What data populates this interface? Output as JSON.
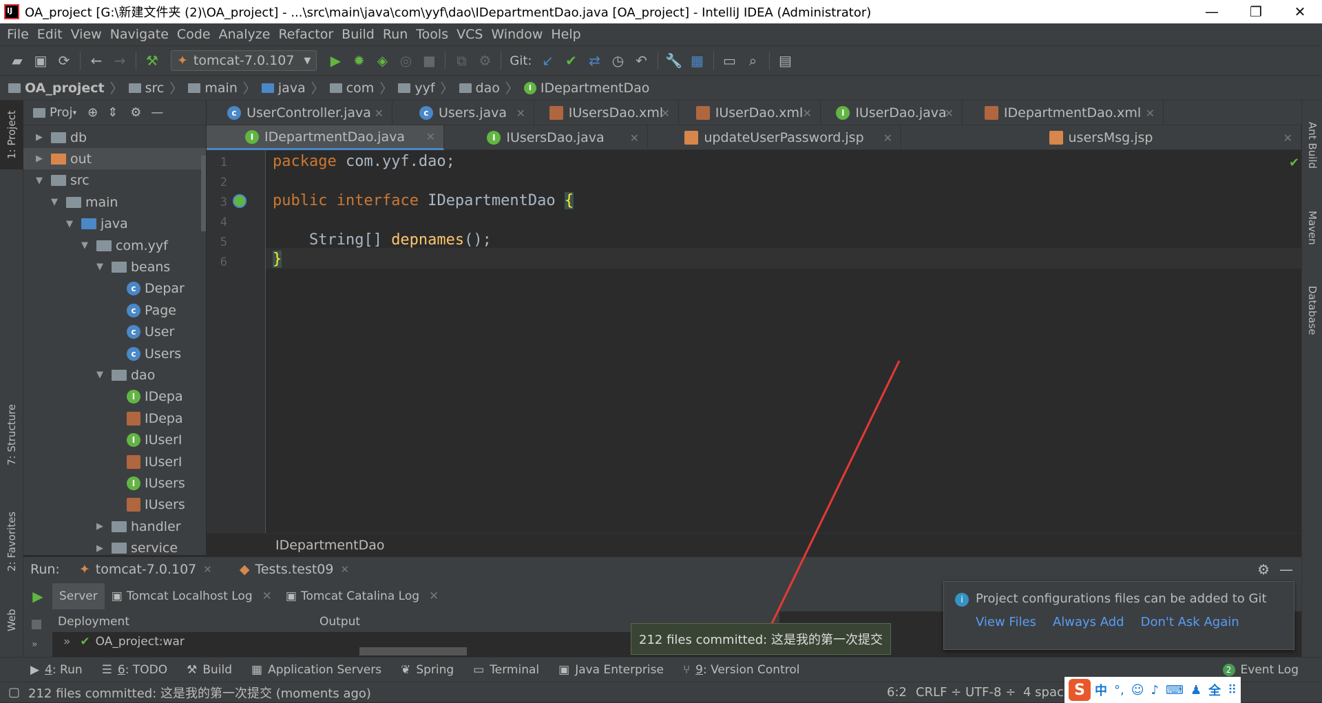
{
  "window": {
    "title": "OA_project [G:\\新建文件夹 (2)\\OA_project] - ...\\src\\main\\java\\com\\yyf\\dao\\IDepartmentDao.java [OA_project] - IntelliJ IDEA (Administrator)",
    "minimize": "—",
    "restore": "❐",
    "close": "✕"
  },
  "menu": [
    "File",
    "Edit",
    "View",
    "Navigate",
    "Code",
    "Analyze",
    "Refactor",
    "Build",
    "Run",
    "Tools",
    "VCS",
    "Window",
    "Help"
  ],
  "toolbar": {
    "run_config": "tomcat-7.0.107",
    "git_label": "Git:"
  },
  "breadcrumb": [
    "OA_project",
    "src",
    "main",
    "java",
    "com",
    "yyf",
    "dao",
    "IDepartmentDao"
  ],
  "left_stripe": {
    "project": "1: Project",
    "structure": "7: Structure",
    "favorites": "2: Favorites",
    "web": "Web"
  },
  "right_stripe": {
    "ant": "Ant Build",
    "maven": "Maven",
    "database": "Database"
  },
  "project_panel": {
    "title": "Proj",
    "tree": [
      {
        "label": "db",
        "type": "folder",
        "indent": 0,
        "arrow": "▶"
      },
      {
        "label": "out",
        "type": "folder-orange",
        "indent": 0,
        "arrow": "▶"
      },
      {
        "label": "src",
        "type": "folder",
        "indent": 0,
        "arrow": "▼"
      },
      {
        "label": "main",
        "type": "folder",
        "indent": 1,
        "arrow": "▼"
      },
      {
        "label": "java",
        "type": "folder-blue",
        "indent": 2,
        "arrow": "▼"
      },
      {
        "label": "com.yyf",
        "type": "folder",
        "indent": 3,
        "arrow": "▼"
      },
      {
        "label": "beans",
        "type": "folder",
        "indent": 4,
        "arrow": "▼"
      },
      {
        "label": "Depar",
        "type": "class",
        "indent": 5
      },
      {
        "label": "Page",
        "type": "class",
        "indent": 5
      },
      {
        "label": "User",
        "type": "class",
        "indent": 5
      },
      {
        "label": "Users",
        "type": "class",
        "indent": 5
      },
      {
        "label": "dao",
        "type": "folder",
        "indent": 4,
        "arrow": "▼"
      },
      {
        "label": "IDepa",
        "type": "interface",
        "indent": 5
      },
      {
        "label": "IDepa",
        "type": "xml",
        "indent": 5
      },
      {
        "label": "IUserI",
        "type": "interface",
        "indent": 5
      },
      {
        "label": "IUserI",
        "type": "xml",
        "indent": 5
      },
      {
        "label": "IUsers",
        "type": "interface",
        "indent": 5
      },
      {
        "label": "IUsers",
        "type": "xml",
        "indent": 5
      },
      {
        "label": "handler",
        "type": "folder",
        "indent": 4,
        "arrow": "▶"
      },
      {
        "label": "service",
        "type": "folder",
        "indent": 4,
        "arrow": "▶"
      }
    ]
  },
  "tabs_row1": [
    {
      "label": "UserController.java",
      "icon": "class"
    },
    {
      "label": "Users.java",
      "icon": "class"
    },
    {
      "label": "IUsersDao.xml",
      "icon": "xml"
    },
    {
      "label": "IUserDao.xml",
      "icon": "xml"
    },
    {
      "label": "IUserDao.java",
      "icon": "interface"
    },
    {
      "label": "IDepartmentDao.xml",
      "icon": "xml"
    }
  ],
  "tabs_row2": [
    {
      "label": "IDepartmentDao.java",
      "icon": "interface",
      "active": true
    },
    {
      "label": "IUsersDao.java",
      "icon": "interface"
    },
    {
      "label": "updateUserPassword.jsp",
      "icon": "jsp"
    },
    {
      "label": "usersMsg.jsp",
      "icon": "jsp"
    }
  ],
  "editor": {
    "lines": [
      "1",
      "2",
      "3",
      "4",
      "5",
      "6"
    ],
    "code": {
      "l1_kw": "package",
      "l1_rest": " com.yyf.dao;",
      "l3_kw1": "public",
      "l3_kw2": "interface",
      "l3_name": " IDepartmentDao ",
      "l3_brace": "{",
      "l5_type": "    String[] ",
      "l5_fn": "depnames",
      "l5_rest": "();",
      "l6": "}"
    },
    "footer": "IDepartmentDao"
  },
  "run": {
    "label": "Run:",
    "tabs": [
      "tomcat-7.0.107",
      "Tests.test09"
    ],
    "subtabs": [
      "Server",
      "Tomcat Localhost Log",
      "Tomcat Catalina Log"
    ],
    "col_deployment": "Deployment",
    "col_output": "Output",
    "deploy_item": "OA_project:war"
  },
  "notification": {
    "text": "Project configurations files can be added to Git",
    "view_files": "View Files",
    "always_add": "Always Add",
    "dont_ask": "Don't Ask Again"
  },
  "commit_popup": "212 files committed: 这是我的第一次提交",
  "tool_windows": [
    {
      "num": "4",
      "label": ": Run"
    },
    {
      "num": "6",
      "label": ": TODO"
    },
    {
      "num": "",
      "label": "Build"
    },
    {
      "num": "",
      "label": "Application Servers"
    },
    {
      "num": "",
      "label": "Spring"
    },
    {
      "num": "",
      "label": "Terminal"
    },
    {
      "num": "",
      "label": "Java Enterprise"
    },
    {
      "num": "9",
      "label": ": Version Control"
    }
  ],
  "event_log": {
    "count": "2",
    "label": "Event Log"
  },
  "status": {
    "message": "212 files committed: 这是我的第一次提交 (moments ago)",
    "position": "6:2",
    "line_sep": "CRLF ÷",
    "encoding": "UTF-8 ÷",
    "indent": "4 spac",
    "ime": [
      "中",
      "°,",
      "☺",
      "♪",
      "⌨",
      "♟",
      "全",
      "⠿"
    ]
  },
  "colors": {
    "accent": "#4a88c7",
    "keyword": "#cc7832",
    "function": "#ffc66d",
    "green": "#62b543",
    "arrow_red": "#e53935"
  }
}
